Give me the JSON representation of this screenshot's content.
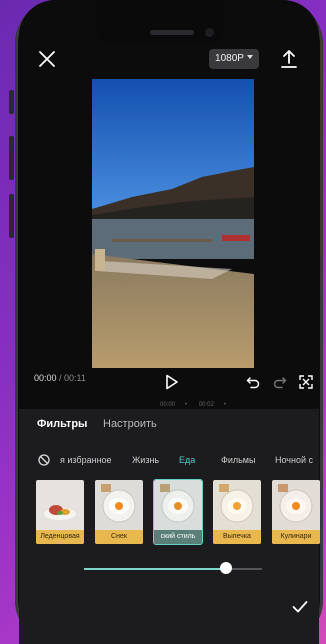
{
  "header": {
    "resolution": "1080P",
    "close_icon": "close-icon",
    "export_icon": "export-icon"
  },
  "player": {
    "current_time": "00:00",
    "separator": " / ",
    "total_time": "00:11",
    "ruler_marks": [
      "00:00",
      "•",
      "00:02",
      "•"
    ]
  },
  "tabs": [
    {
      "label": "Фильтры",
      "active": true
    },
    {
      "label": "Настроить",
      "active": false
    }
  ],
  "categories": [
    {
      "label": "я избранное",
      "selected": false
    },
    {
      "label": "Жизнь",
      "selected": false
    },
    {
      "label": "Еда",
      "selected": true
    },
    {
      "label": "Фильмы",
      "selected": false
    },
    {
      "label": "Ночной с",
      "selected": false
    }
  ],
  "filters": [
    {
      "label": "Леденцовая",
      "selected": false
    },
    {
      "label": "Снек",
      "selected": false
    },
    {
      "label": "ский стиль",
      "selected": true
    },
    {
      "label": "Выпечка",
      "selected": false
    },
    {
      "label": "Кулинари",
      "selected": false
    }
  ],
  "intensity": 0.8,
  "colors": {
    "accent": "#44d0c4",
    "filter_label_bg": "#e8b84e",
    "panel_bg": "#1c1c1e"
  }
}
